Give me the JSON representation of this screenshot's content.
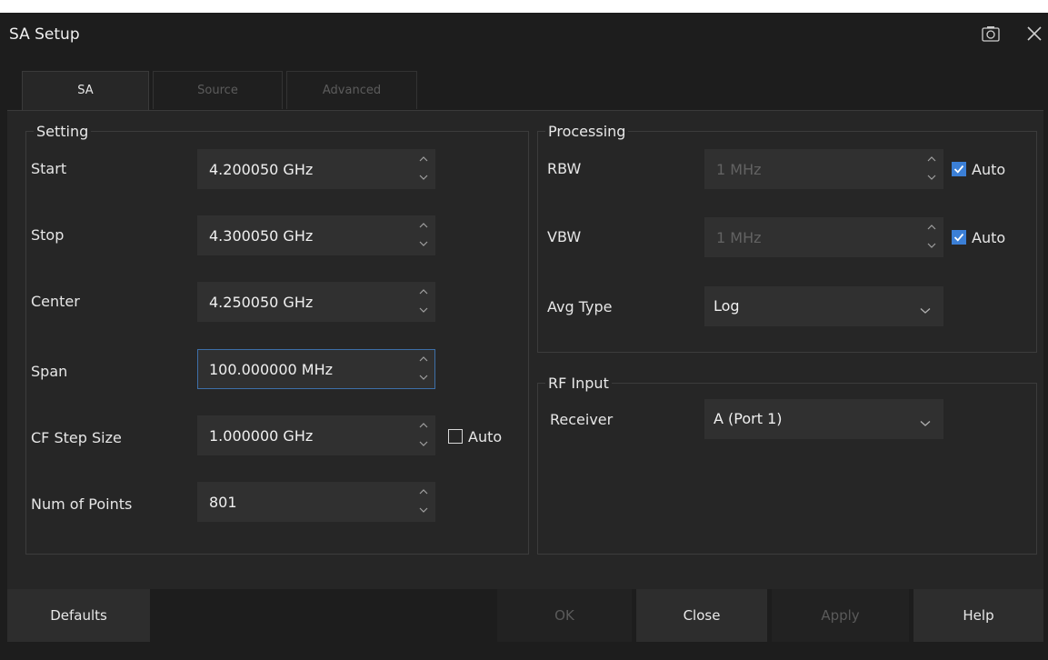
{
  "window": {
    "title": "SA Setup"
  },
  "tabs": [
    {
      "label": "SA",
      "active": true
    },
    {
      "label": "Source",
      "active": false
    },
    {
      "label": "Advanced",
      "active": false
    }
  ],
  "setting": {
    "legend": "Setting",
    "rows": [
      {
        "label": "Start",
        "value": "4.200050 GHz"
      },
      {
        "label": "Stop",
        "value": "4.300050 GHz"
      },
      {
        "label": "Center",
        "value": "4.250050 GHz"
      },
      {
        "label": "Span",
        "value": "100.000000 MHz"
      },
      {
        "label": "CF Step Size",
        "value": "1.000000 GHz",
        "auto_label": "Auto",
        "auto_checked": false
      },
      {
        "label": "Num of Points",
        "value": "801"
      }
    ]
  },
  "processing": {
    "legend": "Processing",
    "rbw": {
      "label": "RBW",
      "value": "1 MHz",
      "auto_label": "Auto",
      "auto_checked": true
    },
    "vbw": {
      "label": "VBW",
      "value": "1 MHz",
      "auto_label": "Auto",
      "auto_checked": true
    },
    "avg_type": {
      "label": "Avg Type",
      "value": "Log"
    }
  },
  "rf_input": {
    "legend": "RF Input",
    "receiver": {
      "label": "Receiver",
      "value": "A (Port 1)"
    }
  },
  "footer": {
    "defaults": "Defaults",
    "ok": "OK",
    "close": "Close",
    "apply": "Apply",
    "help": "Help"
  },
  "colors": {
    "background": "#1d1d1d",
    "panel": "#262626",
    "field": "#303030",
    "accent_check": "#3b7fd6",
    "focus_border": "#3d6fa8"
  },
  "icons": [
    "screenshot-icon",
    "close-icon",
    "chevron-up-icon",
    "chevron-down-icon",
    "checkmark-icon"
  ]
}
